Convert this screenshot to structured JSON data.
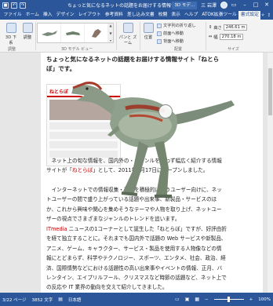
{
  "titlebar": {
    "title": "ちょっと気になるネットの話題をお届けする情報サイト・・・",
    "tools": "3D モデ...",
    "user": "三 岩澤",
    "quick_icons": [
      "save-icon",
      "undo-icon",
      "redo-icon"
    ]
  },
  "tabs": [
    "ファイル",
    "ホーム",
    "挿入",
    "デザイン",
    "レイアウト",
    "参考資料",
    "差し込み文書",
    "校閲",
    "表示",
    "ヘルプ",
    "ATOK拡張ツール",
    "書式設定"
  ],
  "active_tab": "書式設定",
  "ribbon": {
    "btn_3d_model": "3D 下 系",
    "btn_reset": "調整",
    "gallery_label": "3D モデル ビュー",
    "pan_zoom": "パンと ズーム",
    "position": "位置",
    "wrap": "文字列の折り返し",
    "forward": "前面へ移動",
    "backward": "背面へ移動",
    "arrange_label": "配置",
    "height_label": "高さ",
    "height_value": "246.61 m",
    "width_label": "幅",
    "width_value": "270.18 m",
    "size_label": "サイズ",
    "adjust_label": "調整"
  },
  "document": {
    "heading": "ちょっと気になるネットの話題をお届けする情報サイト「ねとらぼ」です。",
    "p1_a": "　ネット上の旬な情報を、国内外の・ジャンルを問わず幅広く紹介する情報サイトが「",
    "p1_link": "ねとらぼ",
    "p1_b": "」として、2011年4月17日にオープンしました。",
    "p2": "　インターネットでの情報収集・発信を積極的に行うユーザー向けに、ネットユーザーの間で盛り上がっている話題や出来事、新製品・サービスのほか、これから興味や関心を集めそうなテーマや人物を取り上げ、ネットユーザーの視点でさまざまなジャンルのトレンドを追います。",
    "p3_link": "ITmedia",
    "p3": " ニュースの1コーナーとして誕生した「ねとらぼ」ですが、好評由折を経て独立することに。それまでも国内外で話題の Web サービスや新製品、アニメ、ゲーム、キャラクター、サービス・製品を使用する人物像などの情報にとどまらず、科学やテクノロジー、スポーツ、エンタメ、社会、政治、経済、国際情勢などにおける話題性の高い出来事やイベントの情報、正月、バレンタイン、エイプリルフール、クリスマスなど時節の話題など、ネット上での反応や IT 業界の動向を交えて紹介してきました。",
    "shot_logo": "ねとらぼ"
  },
  "statusbar": {
    "page": "3/22 ページ",
    "words": "3852 文字",
    "lang": "日本語",
    "zoom": "100%"
  },
  "colors": {
    "accent": "#2b579a",
    "link": "#c00000"
  }
}
